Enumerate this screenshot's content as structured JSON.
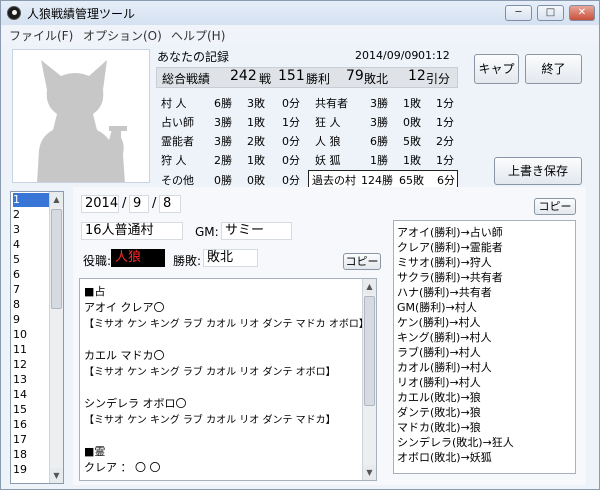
{
  "window": {
    "title": "人狼戦績管理ツール",
    "controls": [
      "─",
      "□",
      "✕"
    ]
  },
  "menu": [
    "ファイル(F)",
    "オプション(O)",
    "ヘルプ(H)"
  ],
  "record": {
    "title": "あなたの記録",
    "date": "2014/09/09",
    "time": "01:12",
    "summary": {
      "label": "総合戦績",
      "games": "242",
      "games_unit": "戦",
      "wins": "151",
      "wins_unit": "勝利",
      "losses": "79",
      "losses_unit": "敗北",
      "draws": "12",
      "draws_unit": "引分"
    },
    "left_roles": [
      {
        "role": "村 人",
        "w": "6勝",
        "l": "3敗",
        "d": "0分"
      },
      {
        "role": "占い師",
        "w": "3勝",
        "l": "1敗",
        "d": "1分"
      },
      {
        "role": "霊能者",
        "w": "3勝",
        "l": "2敗",
        "d": "0分"
      },
      {
        "role": "狩 人",
        "w": "2勝",
        "l": "1敗",
        "d": "0分"
      },
      {
        "role": "その他",
        "w": "0勝",
        "l": "0敗",
        "d": "0分"
      }
    ],
    "right_roles": [
      {
        "role": "共有者",
        "w": "3勝",
        "l": "1敗",
        "d": "1分"
      },
      {
        "role": "狂 人",
        "w": "3勝",
        "l": "0敗",
        "d": "1分"
      },
      {
        "role": "人 狼",
        "w": "6勝",
        "l": "5敗",
        "d": "2分"
      },
      {
        "role": "妖 狐",
        "w": "1勝",
        "l": "1敗",
        "d": "1分"
      }
    ],
    "past": {
      "label": "過去の村",
      "w": "124勝",
      "l": "65敗",
      "d": "6分"
    }
  },
  "buttons": {
    "cap": "キャプ",
    "end": "終了",
    "overwrite": "上書き保存",
    "copy": "コピー"
  },
  "game_list": [
    "1",
    "2",
    "3",
    "4",
    "5",
    "6",
    "7",
    "8",
    "9",
    "10",
    "11",
    "12",
    "13",
    "14",
    "15",
    "16",
    "17",
    "18",
    "19"
  ],
  "game_list_selected": "1",
  "game": {
    "year": "2014",
    "month": "9",
    "day": "8",
    "sep": "/",
    "village": "16人普通村",
    "gm_label": "GM:",
    "gm": "サミー",
    "role_label": "役職:",
    "role": "人狼",
    "result_label": "勝敗:",
    "result": "敗北"
  },
  "notes": [
    "■占",
    "アオイ クレア〇",
    "【ミサオ ケン キング ラブ カオル リオ ダンテ マドカ オボロ】",
    "",
    "カエル マドカ〇",
    "【ミサオ ケン キング ラブ カオル リオ ダンテ オボロ】",
    "",
    "シンデレラ オボロ〇",
    "【ミサオ ケン キング ラブ カオル リオ ダンテ マドカ】",
    "",
    "■霊",
    "クレア ： 〇 〇"
  ],
  "results": [
    "アオイ(勝利)→占い師",
    "クレア(勝利)→霊能者",
    "ミサオ(勝利)→狩人",
    "サクラ(勝利)→共有者",
    "ハナ(勝利)→共有者",
    "GM(勝利)→村人",
    "ケン(勝利)→村人",
    "キング(勝利)→村人",
    "ラブ(勝利)→村人",
    "カオル(勝利)→村人",
    "リオ(勝利)→村人",
    "カエル(敗北)→狼",
    "ダンテ(敗北)→狼",
    "マドカ(敗北)→狼",
    "シンデレラ(敗北)→狂人",
    "オボロ(敗北)→妖狐"
  ],
  "colors": {
    "role_bg": "#000000",
    "role_text": "#ff2a2a",
    "selection": "#3875d7"
  }
}
